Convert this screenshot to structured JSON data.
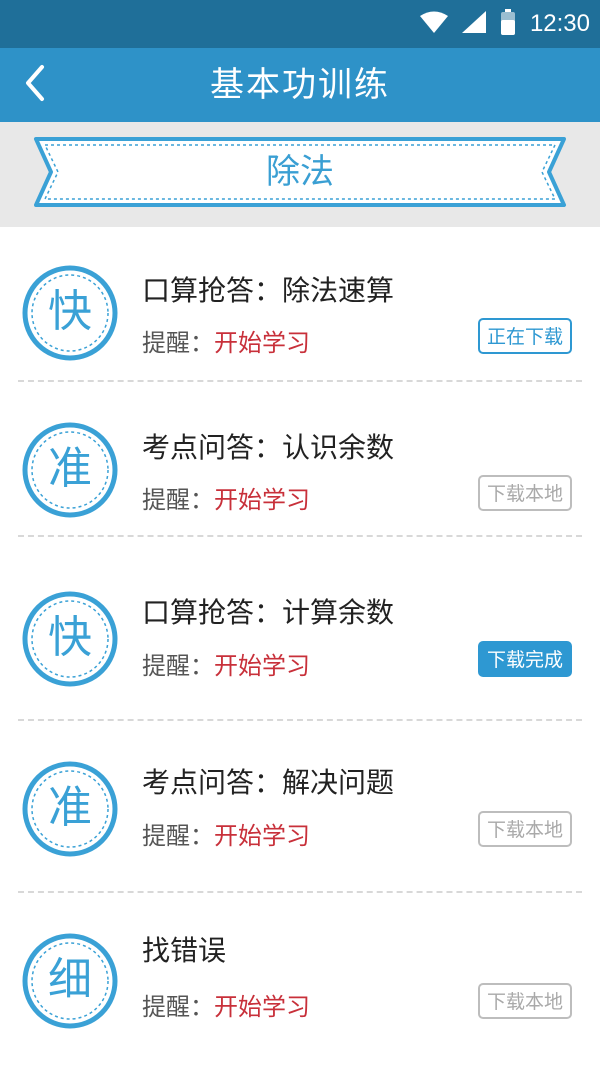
{
  "status_bar": {
    "time": "12:30",
    "icons": [
      "wifi-icon",
      "signal-icon",
      "battery-icon"
    ]
  },
  "nav": {
    "title": "基本功训练",
    "back_icon": "chevron-left-icon"
  },
  "banner": {
    "title": "除法"
  },
  "items": [
    {
      "badge": "快",
      "title": "口算抢答：除法速算",
      "reminder_label": "提醒：",
      "reminder_value": "开始学习",
      "button": "正在下载",
      "button_state": "downloading"
    },
    {
      "badge": "准",
      "title": "考点问答：认识余数",
      "reminder_label": "提醒：",
      "reminder_value": "开始学习",
      "button": "下载本地",
      "button_state": "idle"
    },
    {
      "badge": "快",
      "title": "口算抢答：计算余数",
      "reminder_label": "提醒：",
      "reminder_value": "开始学习",
      "button": "下载完成",
      "button_state": "done"
    },
    {
      "badge": "准",
      "title": "考点问答：解决问题",
      "reminder_label": "提醒：",
      "reminder_value": "开始学习",
      "button": "下载本地",
      "button_state": "idle"
    },
    {
      "badge": "细",
      "title": "找错误",
      "reminder_label": "提醒：",
      "reminder_value": "开始学习",
      "button": "下载本地",
      "button_state": "idle"
    }
  ],
  "colors": {
    "status_bar": "#1f6f99",
    "nav_bar": "#2e92c8",
    "accent": "#2e98d2",
    "reminder": "#c8303a"
  }
}
